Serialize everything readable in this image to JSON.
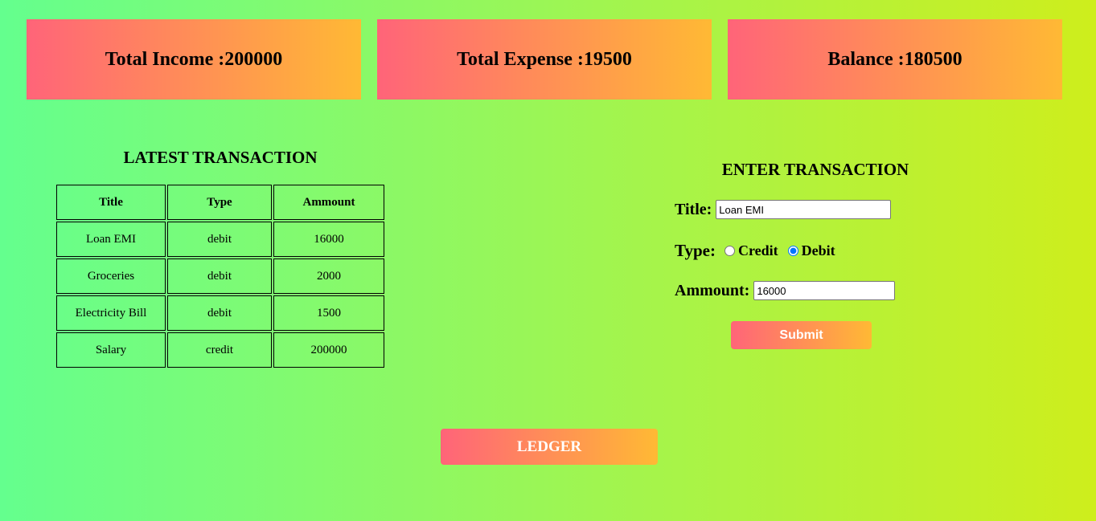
{
  "summary": {
    "income_label": "Total Income :",
    "income_value": "200000",
    "expense_label": "Total Expense :",
    "expense_value": "19500",
    "balance_label": "Balance :",
    "balance_value": "180500"
  },
  "latest": {
    "heading": "LATEST TRANSACTION",
    "columns": [
      "Title",
      "Type",
      "Ammount"
    ],
    "rows": [
      [
        "Loan EMI",
        "debit",
        "16000"
      ],
      [
        "Groceries",
        "debit",
        "2000"
      ],
      [
        "Electricity Bill",
        "debit",
        "1500"
      ],
      [
        "Salary",
        "credit",
        "200000"
      ]
    ]
  },
  "form": {
    "heading": "ENTER TRANSACTION",
    "title_label": "Title:",
    "title_value": "Loan EMI",
    "type_label": "Type:",
    "credit_label": "Credit",
    "debit_label": "Debit",
    "selected_type": "Debit",
    "amount_label": "Ammount:",
    "amount_value": "16000",
    "submit_label": "Submit"
  },
  "ledger_label": "LEDGER",
  "colors": {
    "background_start": "#64ff8e",
    "background_end": "#ceee1c",
    "accent_start": "#ff6479",
    "accent_end": "#ffb934"
  }
}
